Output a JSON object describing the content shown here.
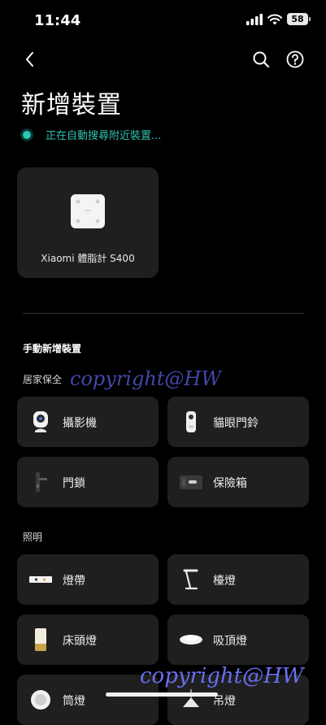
{
  "status": {
    "time": "11:44",
    "battery": "58"
  },
  "page": {
    "title": "新增裝置",
    "scanning_text": "正在自動搜尋附近裝置..."
  },
  "found": [
    {
      "name": "Xiaomi 體脂計 S400",
      "icon": "body-scale-icon"
    }
  ],
  "manual": {
    "header": "手動新增裝置",
    "groups": [
      {
        "label": "居家保全",
        "items": [
          {
            "label": "攝影機",
            "icon": "camera-icon"
          },
          {
            "label": "貓眼門鈴",
            "icon": "doorbell-icon"
          },
          {
            "label": "門鎖",
            "icon": "door-lock-icon"
          },
          {
            "label": "保險箱",
            "icon": "safe-icon"
          }
        ]
      },
      {
        "label": "照明",
        "items": [
          {
            "label": "燈帶",
            "icon": "light-strip-icon"
          },
          {
            "label": "檯燈",
            "icon": "desk-lamp-icon"
          },
          {
            "label": "床頭燈",
            "icon": "bedside-lamp-icon"
          },
          {
            "label": "吸頂燈",
            "icon": "ceiling-light-icon"
          },
          {
            "label": "筒燈",
            "icon": "downlight-icon"
          },
          {
            "label": "吊燈",
            "icon": "pendant-light-icon"
          }
        ]
      }
    ]
  },
  "watermark": "copyright@HW",
  "colors": {
    "accent": "#2fc2b0",
    "background": "#000000",
    "card": "#1f1f1f"
  }
}
